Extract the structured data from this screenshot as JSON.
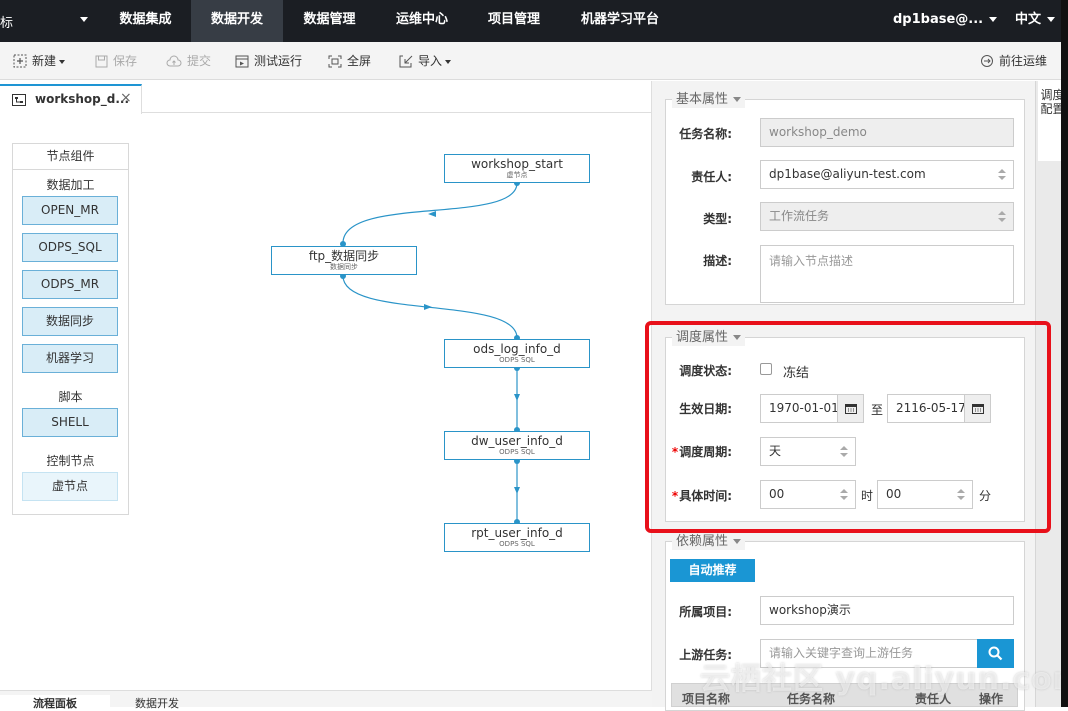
{
  "topnav": {
    "brand_tail": "标",
    "items": [
      "数据集成",
      "数据开发",
      "数据管理",
      "运维中心",
      "项目管理",
      "机器学习平台"
    ],
    "active_index": 1,
    "user": "dp1base@...",
    "lang": "中文"
  },
  "toolbar": {
    "new": "新建",
    "save": "保存",
    "submit": "提交",
    "test_run": "测试运行",
    "fullscreen": "全屏",
    "import": "导入",
    "goto_ops": "前往运维"
  },
  "editor_tab": {
    "label": "workshop_d...",
    "close": "×"
  },
  "palette": {
    "title": "节点组件",
    "group_data": "数据加工",
    "items_data": [
      "OPEN_MR",
      "ODPS_SQL",
      "ODPS_MR",
      "数据同步",
      "机器学习"
    ],
    "group_script": "脚本",
    "items_script": [
      "SHELL"
    ],
    "group_control": "控制节点",
    "items_control": [
      "虚节点"
    ]
  },
  "flow": {
    "nodes": [
      {
        "name": "workshop_start",
        "type": "虚节点"
      },
      {
        "name": "ftp_数据同步",
        "type": "数据同步"
      },
      {
        "name": "ods_log_info_d",
        "type": "ODPS SQL"
      },
      {
        "name": "dw_user_info_d",
        "type": "ODPS SQL"
      },
      {
        "name": "rpt_user_info_d",
        "type": "ODPS SQL"
      }
    ],
    "accent": "#2a94c8"
  },
  "bottom_tabs": [
    "流程面板",
    "数据开发"
  ],
  "right_tab": "调度配置",
  "basic": {
    "legend": "基本属性",
    "task_name_label": "任务名称:",
    "task_name": "workshop_demo",
    "owner_label": "责任人:",
    "owner": "dp1base@aliyun-test.com",
    "type_label": "类型:",
    "type": "工作流任务",
    "desc_label": "描述:",
    "desc_placeholder": "请输入节点描述"
  },
  "schedule": {
    "legend": "调度属性",
    "status_label": "调度状态:",
    "freeze": "冻结",
    "date_label": "生效日期:",
    "date_from": "1970-01-01",
    "to": "至",
    "date_to": "2116-05-17",
    "cycle_label": "调度周期:",
    "cycle": "天",
    "time_label": "具体时间:",
    "hour": "00",
    "hour_unit": "时",
    "minute": "00",
    "minute_unit": "分",
    "required_mark": "*"
  },
  "depend": {
    "legend": "依赖属性",
    "auto_btn": "自动推荐",
    "project_label": "所属项目:",
    "project": "workshop演示",
    "upstream_label": "上游任务:",
    "upstream_placeholder": "请输入关键字查询上游任务",
    "columns": [
      "项目名称",
      "任务名称",
      "责任人",
      "操作"
    ]
  },
  "watermark": "云栖社区 yq.aliyun.com",
  "colors": {
    "nav_bg": "#1b1e23",
    "primary": "#1a96d4",
    "highlight": "#e8101a"
  }
}
